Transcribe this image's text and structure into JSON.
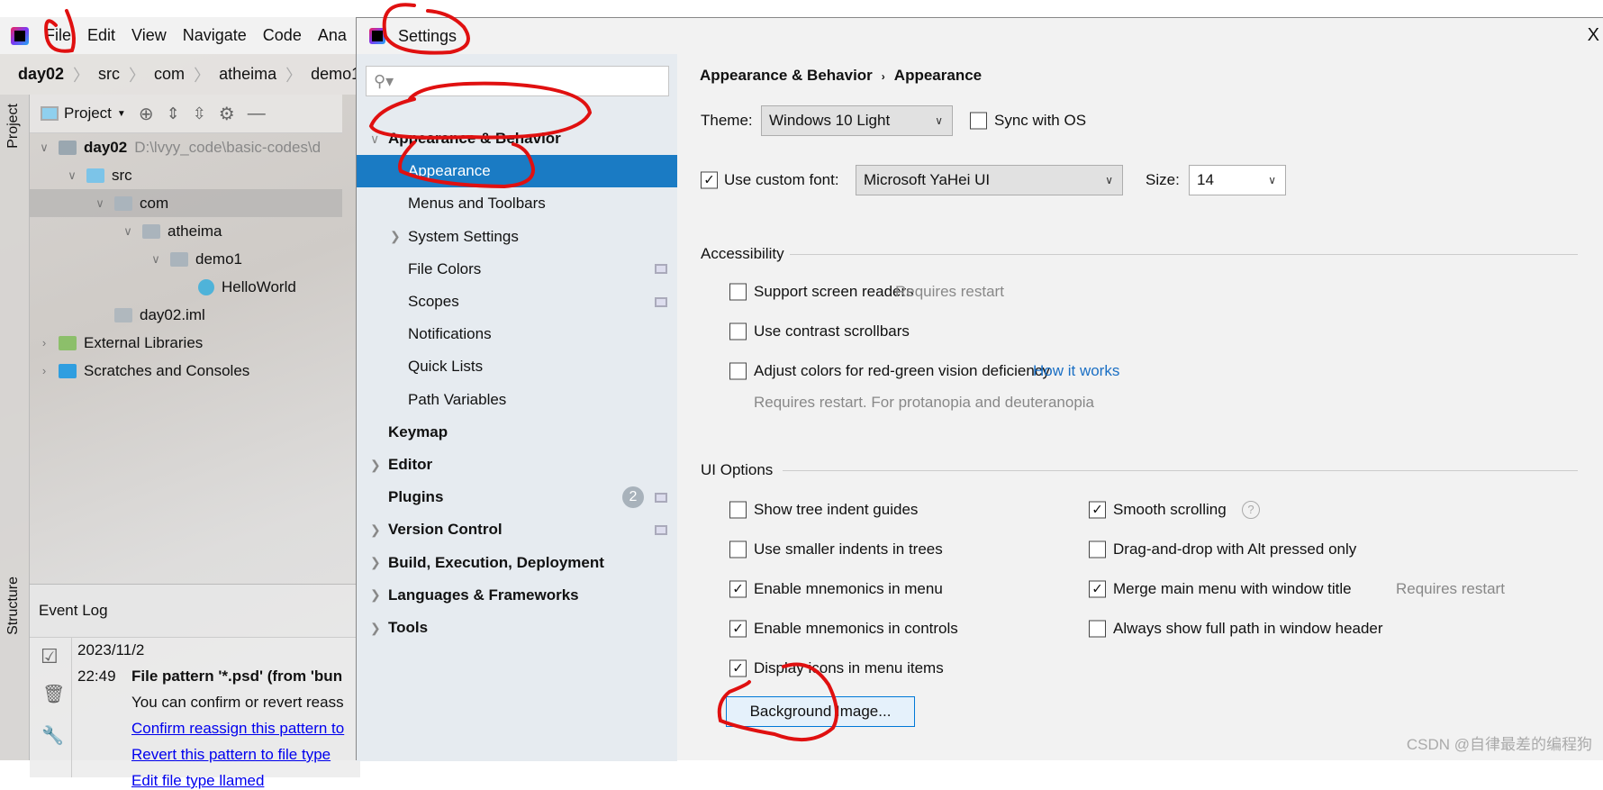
{
  "ide": {
    "menu": [
      {
        "label": "File",
        "u": "F"
      },
      {
        "label": "Edit",
        "u": "E"
      },
      {
        "label": "View",
        "u": "V"
      },
      {
        "label": "Navigate",
        "u": "N"
      },
      {
        "label": "Code",
        "u": "C"
      },
      {
        "label": "Ana",
        "u": ""
      }
    ],
    "breadcrumb": [
      "day02",
      "src",
      "com",
      "atheima",
      "demo1"
    ],
    "project_tab": "Project",
    "structure_tab": "Structure",
    "project_dropdown": "Project",
    "tree": [
      {
        "label": "day02",
        "path": "D:\\lvyy_code\\basic-codes\\d",
        "depth": 0,
        "exp": "v",
        "icon": "module-folder-icon",
        "bold": true
      },
      {
        "label": "src",
        "depth": 1,
        "exp": "v",
        "icon": "source-folder-icon"
      },
      {
        "label": "com",
        "depth": 2,
        "exp": "v",
        "icon": "package-icon",
        "selected": true
      },
      {
        "label": "atheima",
        "depth": 3,
        "exp": "v",
        "icon": "package-icon"
      },
      {
        "label": "demo1",
        "depth": 4,
        "exp": "v",
        "icon": "package-icon"
      },
      {
        "label": "HelloWorld",
        "depth": 5,
        "exp": "",
        "icon": "java-class-icon"
      },
      {
        "label": "day02.iml",
        "depth": 2,
        "exp": "",
        "icon": "iml-file-icon"
      },
      {
        "label": "External Libraries",
        "depth": 0,
        "exp": ">",
        "icon": "libraries-icon"
      },
      {
        "label": "Scratches and Consoles",
        "depth": 0,
        "exp": ">",
        "icon": "scratches-icon"
      }
    ],
    "event_log": {
      "title": "Event Log",
      "date": "2023/11/2",
      "time": "22:49",
      "message_title": "File pattern '*.psd' (from 'bun",
      "message_body": "You can confirm or revert reass",
      "links": [
        "Confirm reassign this pattern to",
        "Revert this pattern to file type ",
        "Edit file type llamed"
      ]
    }
  },
  "settings": {
    "title": "Settings",
    "search_placeholder": "",
    "nav": [
      {
        "label": "Appearance & Behavior",
        "bold": true,
        "indent": 0,
        "arrow": "v"
      },
      {
        "label": "Appearance",
        "indent": 1,
        "selected": true
      },
      {
        "label": "Menus and Toolbars",
        "indent": 1
      },
      {
        "label": "System Settings",
        "indent": 1,
        "arrow": ">"
      },
      {
        "label": "File Colors",
        "indent": 1,
        "pin": true
      },
      {
        "label": "Scopes",
        "indent": 1,
        "pin": true
      },
      {
        "label": "Notifications",
        "indent": 1
      },
      {
        "label": "Quick Lists",
        "indent": 1
      },
      {
        "label": "Path Variables",
        "indent": 1
      },
      {
        "label": "Keymap",
        "bold": true,
        "indent": 0
      },
      {
        "label": "Editor",
        "bold": true,
        "indent": 0,
        "arrow": ">"
      },
      {
        "label": "Plugins",
        "bold": true,
        "indent": 0,
        "badge": "2",
        "pin": true
      },
      {
        "label": "Version Control",
        "bold": true,
        "indent": 0,
        "arrow": ">",
        "pin": true
      },
      {
        "label": "Build, Execution, Deployment",
        "bold": true,
        "indent": 0,
        "arrow": ">"
      },
      {
        "label": "Languages & Frameworks",
        "bold": true,
        "indent": 0,
        "arrow": ">"
      },
      {
        "label": "Tools",
        "bold": true,
        "indent": 0,
        "arrow": ">"
      }
    ],
    "breadcrumb": [
      "Appearance & Behavior",
      "Appearance"
    ],
    "theme_label": "Theme:",
    "theme_value": "Windows 10 Light",
    "sync_os": {
      "label": "Sync with OS",
      "checked": false
    },
    "custom_font": {
      "label": "Use custom font:",
      "checked": true,
      "value": "Microsoft YaHei UI"
    },
    "size_label": "Size:",
    "size_value": "14",
    "accessibility": {
      "title": "Accessibility",
      "options": [
        {
          "label": "Support screen readers",
          "checked": false,
          "hint": "Requires restart"
        },
        {
          "label": "Use contrast scrollbars",
          "checked": false
        },
        {
          "label": "Adjust colors for red-green vision deficiency",
          "checked": false,
          "link": "How it works"
        }
      ],
      "note": "Requires restart. For protanopia and deuteranopia"
    },
    "ui_options": {
      "title": "UI Options",
      "left": [
        {
          "label": "Show tree indent guides",
          "checked": false
        },
        {
          "label": "Use smaller indents in trees",
          "checked": false
        },
        {
          "label": "Enable mnemonics in menu",
          "checked": true
        },
        {
          "label": "Enable mnemonics in controls",
          "checked": true
        },
        {
          "label": "Display icons in menu items",
          "checked": true
        }
      ],
      "right": [
        {
          "label": "Smooth scrolling",
          "checked": true,
          "help": "?"
        },
        {
          "label": "Drag-and-drop with Alt pressed only",
          "checked": false
        },
        {
          "label": "Merge main menu with window title",
          "checked": true,
          "hint": "Requires restart"
        },
        {
          "label": "Always show full path in window header",
          "checked": false
        }
      ],
      "background_button": "Background Image..."
    },
    "close": "X"
  },
  "watermark": "CSDN @自律最差的编程狗",
  "colors": {
    "selection": "#1a7bc4",
    "nav_bg": "#e6ebf0",
    "panel_bg": "#f2f2f2",
    "annotation": "#e01010",
    "link": "#1a6fc4"
  }
}
